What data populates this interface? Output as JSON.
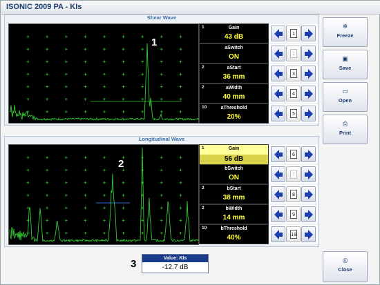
{
  "app": {
    "title": "ISONIC 2009 PA - KIs"
  },
  "shear": {
    "title": "Shear Wave",
    "params": [
      {
        "num": "1",
        "label": "Gain",
        "value": "43 dB",
        "key": "1"
      },
      {
        "num": "",
        "label": "aSwitch",
        "value": "ON",
        "key": "2"
      },
      {
        "num": "2",
        "label": "aStart",
        "value": "36 mm",
        "key": "3"
      },
      {
        "num": "2",
        "label": "aWidth",
        "value": "40 mm",
        "key": "4"
      },
      {
        "num": "10",
        "label": "aThreshold",
        "value": "20%",
        "key": "5"
      }
    ]
  },
  "longitudinal": {
    "title": "Longitudinal Wave",
    "params": [
      {
        "num": "1",
        "label": "Gain",
        "value": "56 dB",
        "key": "6"
      },
      {
        "num": "",
        "label": "bSwitch",
        "value": "ON",
        "key": "7"
      },
      {
        "num": "2",
        "label": "bStart",
        "value": "38 mm",
        "key": "8"
      },
      {
        "num": "2",
        "label": "bWidth",
        "value": "14 mm",
        "key": "9"
      },
      {
        "num": "10",
        "label": "bThreshold",
        "value": "40%",
        "key": "10"
      }
    ]
  },
  "side_buttons": {
    "freeze": {
      "label": "Freeze",
      "icon": "snowflake-icon"
    },
    "save": {
      "label": "Save",
      "icon": "floppy-disk-icon"
    },
    "open": {
      "label": "Open",
      "icon": "open-folder-icon"
    },
    "print": {
      "label": "Print",
      "icon": "printer-icon"
    },
    "close": {
      "label": "Close",
      "icon": "close-circle-icon"
    }
  },
  "markers": {
    "m1": "1",
    "m2": "2",
    "m3": "3"
  },
  "value_box": {
    "label": "Value: KIs",
    "value": "-12.7 dB"
  },
  "colors": {
    "trace": "#33cc33",
    "grid": "#2ebd2e",
    "gate": "#2f6fd6",
    "highlight": "#ffff99",
    "accent": "#1a3b8a",
    "value_text": "#ffff33"
  }
}
